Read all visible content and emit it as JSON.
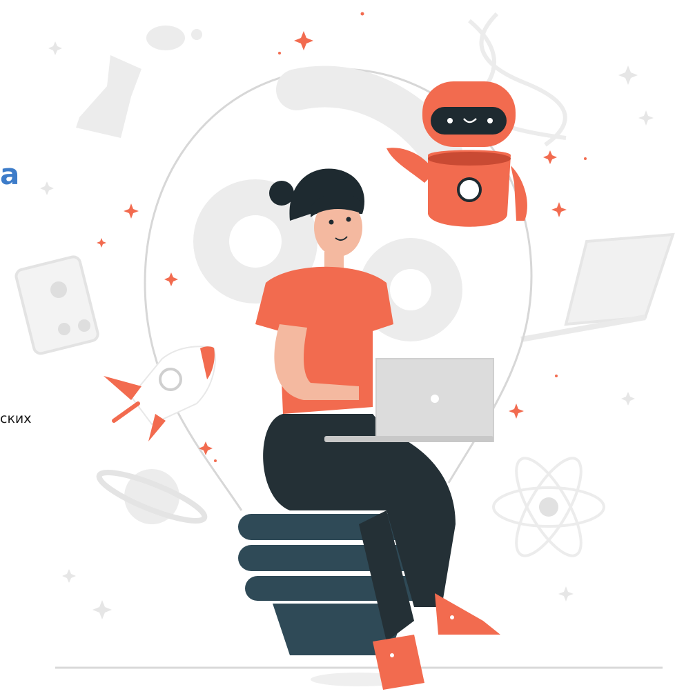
{
  "fragments": {
    "heading_tail": "а",
    "body_tail": "ских"
  },
  "palette": {
    "accent": "#f26b4f",
    "heading_blue": "#3d7cc9",
    "dark_teal": "#2f4a57",
    "dark_pants": "#243036",
    "skin": "#f4b9a0",
    "laptop": "#dcdcdc",
    "light_gray": "#ececec"
  },
  "icons": [
    "robot-icon",
    "rocket-icon",
    "phone-icon",
    "laptop-icon",
    "planet-icon",
    "atom-icon",
    "gear-icon",
    "flask-icon",
    "dna-icon",
    "sparkle-icon"
  ]
}
